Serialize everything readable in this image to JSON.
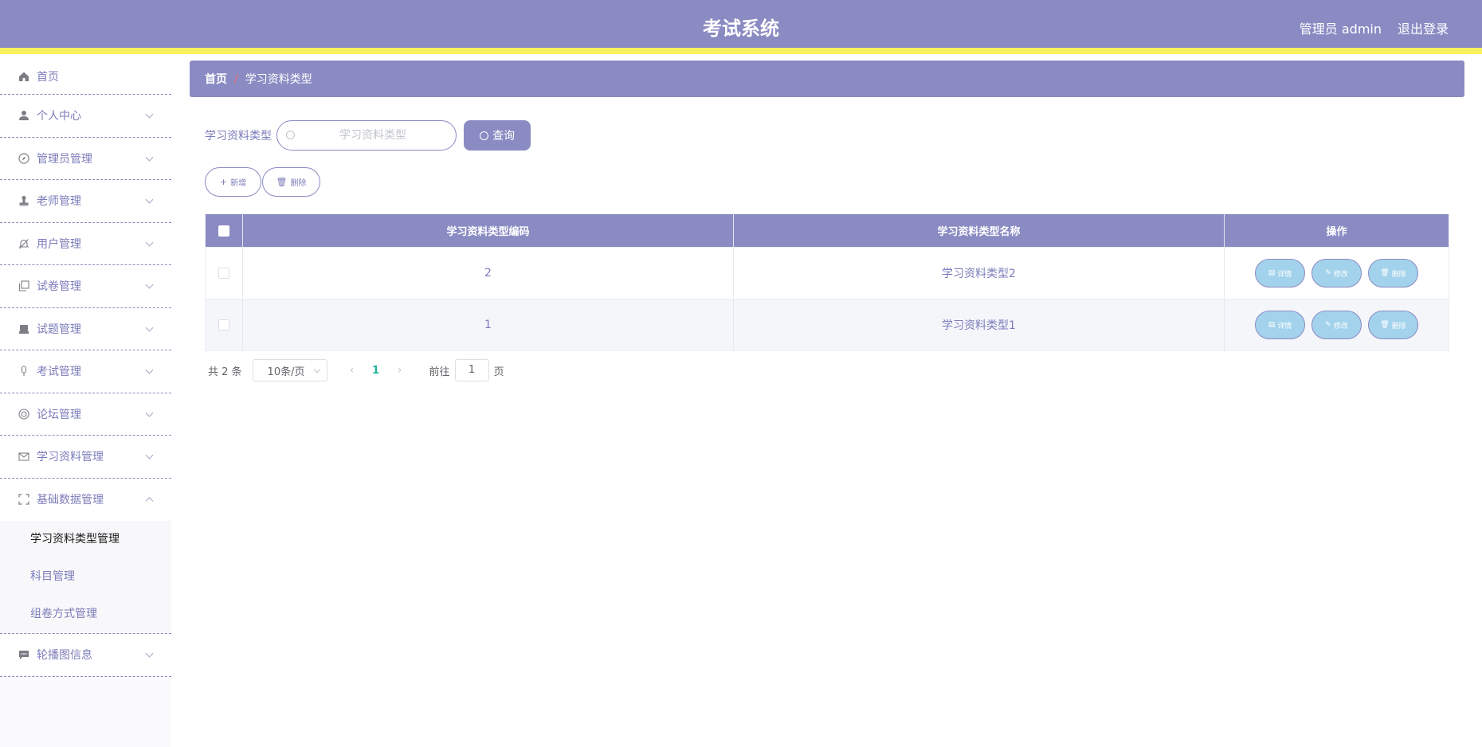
{
  "header": {
    "title": "考试系统",
    "admin_label": "管理员 admin",
    "logout_label": "退出登录"
  },
  "sidebar": {
    "items": [
      {
        "label": "首页",
        "icon": "home-icon"
      },
      {
        "label": "个人中心",
        "icon": "user-icon"
      },
      {
        "label": "管理员管理",
        "icon": "compass-icon"
      },
      {
        "label": "老师管理",
        "icon": "stamp-icon"
      },
      {
        "label": "用户管理",
        "icon": "bell-off-icon"
      },
      {
        "label": "试卷管理",
        "icon": "copy-icon"
      },
      {
        "label": "试题管理",
        "icon": "printer-icon"
      },
      {
        "label": "考试管理",
        "icon": "microphone-icon"
      },
      {
        "label": "论坛管理",
        "icon": "lifebuoy-icon"
      },
      {
        "label": "学习资料管理",
        "icon": "mail-icon"
      },
      {
        "label": "基础数据管理",
        "icon": "fullscreen-icon"
      },
      {
        "label": "轮播图信息",
        "icon": "chat-icon"
      }
    ],
    "submenu": [
      {
        "label": "学习资料类型管理",
        "active": true
      },
      {
        "label": "科目管理"
      },
      {
        "label": "组卷方式管理"
      }
    ]
  },
  "breadcrumb": {
    "home": "首页",
    "separator": "/",
    "current": "学习资料类型"
  },
  "search": {
    "label": "学习资料类型",
    "placeholder": "学习资料类型",
    "value": "",
    "button_label": "查询"
  },
  "actions": {
    "add_label": "新增",
    "delete_label": "删除"
  },
  "table": {
    "columns": [
      "学习资料类型编码",
      "学习资料类型名称",
      "操作"
    ],
    "rows": [
      {
        "code": "2",
        "name": "学习资料类型2"
      },
      {
        "code": "1",
        "name": "学习资料类型1"
      }
    ],
    "row_actions": {
      "detail": "详情",
      "edit": "修改",
      "delete": "删除"
    }
  },
  "pagination": {
    "total_text": "共 2 条",
    "page_size": "10条/页",
    "current_page": "1",
    "goto_label": "前往",
    "goto_value": "1",
    "page_unit": "页"
  },
  "colors": {
    "primary": "#8a8bc3",
    "accent_bar": "#f8f05c",
    "op_button": "#a3d3ec",
    "active_page": "#1fb19e"
  }
}
